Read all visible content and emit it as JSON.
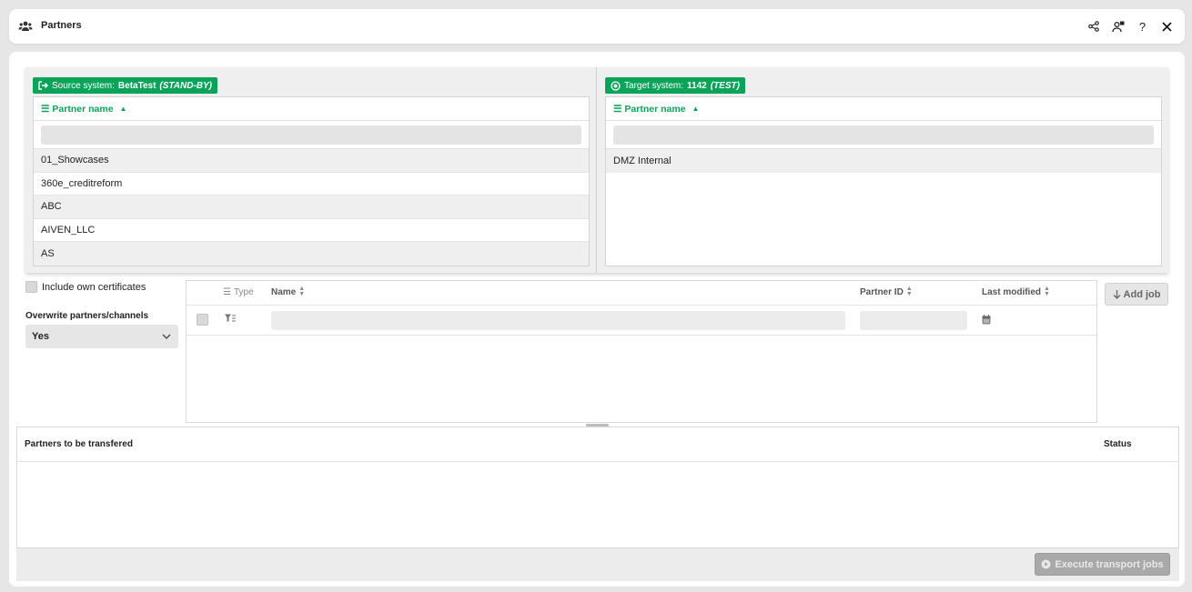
{
  "header": {
    "title": "Partners",
    "icons": [
      "partners-icon",
      "share-icon",
      "user-settings-icon",
      "help-icon",
      "close-icon"
    ]
  },
  "source": {
    "label": "Source system:",
    "name": "BetaTest",
    "state": "(STAND-BY)",
    "column_header": "Partner name",
    "filter_value": "",
    "rows": [
      "01_Showcases",
      "360e_creditreform",
      "ABC",
      "AIVEN_LLC",
      "AS"
    ]
  },
  "target": {
    "label": "Target system:",
    "name": "1142",
    "state": "(TEST)",
    "column_header": "Partner name",
    "filter_value": "",
    "rows": [
      "DMZ Internal"
    ]
  },
  "options": {
    "include_own_certificates": "Include own certificates",
    "include_own_certificates_checked": false,
    "overwrite_label": "Overwrite partners/channels",
    "overwrite_value": "Yes"
  },
  "jobs": {
    "columns": {
      "type": "Type",
      "name": "Name",
      "partner_id": "Partner ID",
      "last_modified": "Last modified"
    },
    "add_job": "Add job"
  },
  "transfer": {
    "title": "Partners to be transfered",
    "status": "Status"
  },
  "footer": {
    "execute": "Execute transport jobs"
  },
  "colors": {
    "accent": "#0aa35a",
    "disabled_button": "#a9a9a9"
  }
}
